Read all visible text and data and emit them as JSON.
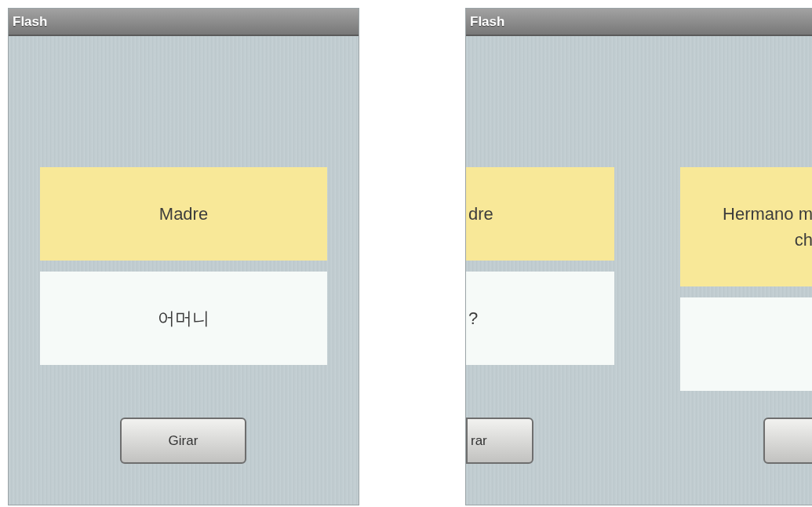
{
  "screens": [
    {
      "title": "Flash",
      "pages": [
        {
          "kind": "whole",
          "front": [
            "Madre"
          ],
          "back": [
            "어머니"
          ],
          "button": "Girar"
        }
      ]
    },
    {
      "title": "Flash",
      "pages": [
        {
          "kind": "cut_left",
          "front": [
            "dre"
          ],
          "back": [
            "?"
          ],
          "button": "rar"
        },
        {
          "kind": "cut_right",
          "front": [
            "Hermano m",
            "ch"
          ]
        }
      ]
    }
  ]
}
